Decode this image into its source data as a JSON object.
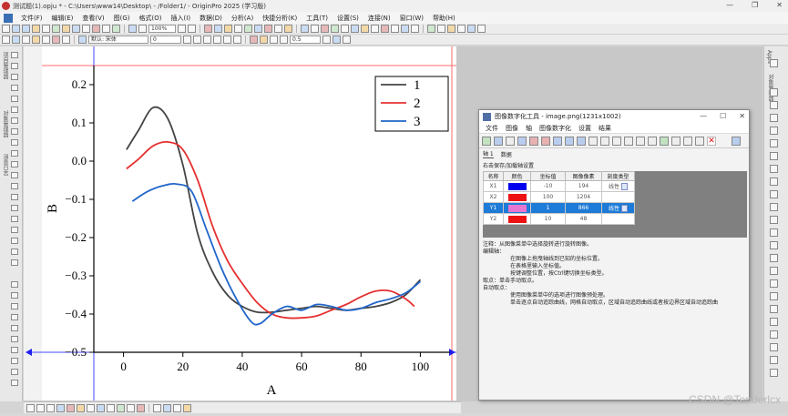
{
  "window": {
    "title": "测试题(1).opju * - C:\\Users\\www14\\Desktop\\ - /Folder1/ - OriginPro 2025 (学习版)",
    "controls": [
      "—",
      "❐",
      "✕"
    ]
  },
  "menubar": {
    "items": [
      "文件(F)",
      "编辑(E)",
      "查看(V)",
      "图(G)",
      "格式(O)",
      "插入(I)",
      "数据(D)",
      "分析(A)",
      "快捷分析(K)",
      "工具(T)",
      "设置(S)",
      "连接(N)",
      "窗口(W)",
      "帮助(H)"
    ]
  },
  "toolbar": {
    "zoom": "100%",
    "font_name": "默认: 宋体",
    "font_size": "0",
    "line_width": "0.5"
  },
  "left_panel": {
    "labels": [
      "项目管理器",
      "对象管理器",
      "消息日志"
    ]
  },
  "right_panel": {
    "labels": [
      "Apps",
      "对象管理器"
    ]
  },
  "graph": {
    "x_axis_title": "A",
    "y_axis_title": "B",
    "legend": [
      "1",
      "2",
      "3"
    ]
  },
  "chart_data": {
    "type": "line",
    "xlabel": "A",
    "ylabel": "B",
    "xlim": [
      -10,
      110
    ],
    "ylim": [
      -0.5,
      0.25
    ],
    "xticks": [
      0,
      20,
      40,
      60,
      80,
      100
    ],
    "yticks": [
      0.2,
      0.1,
      0.0,
      -0.1,
      -0.2,
      -0.3,
      -0.4,
      -0.5
    ],
    "xtick_labels": [
      "0",
      "20",
      "40",
      "60",
      "80",
      "100"
    ],
    "ytick_labels": [
      "0.2",
      "0.1",
      "0.0",
      "−0.1",
      "−0.2",
      "−0.3",
      "−0.4",
      "−0.5"
    ],
    "legend_position": "top-right",
    "series": [
      {
        "name": "1",
        "color": "#444444",
        "x": [
          1,
          5,
          10,
          15,
          20,
          25,
          30,
          35,
          40,
          45,
          50,
          55,
          60,
          65,
          70,
          75,
          80,
          85,
          90,
          95,
          100
        ],
        "y": [
          0.03,
          0.08,
          0.14,
          0.11,
          -0.01,
          -0.19,
          -0.29,
          -0.35,
          -0.38,
          -0.395,
          -0.395,
          -0.39,
          -0.385,
          -0.38,
          -0.385,
          -0.39,
          -0.385,
          -0.38,
          -0.37,
          -0.35,
          -0.31
        ]
      },
      {
        "name": "2",
        "color": "#e53030",
        "x": [
          1,
          5,
          10,
          15,
          20,
          25,
          30,
          35,
          40,
          45,
          50,
          55,
          60,
          65,
          70,
          75,
          80,
          85,
          90,
          95,
          98
        ],
        "y": [
          -0.02,
          0.005,
          0.04,
          0.05,
          0.03,
          -0.05,
          -0.17,
          -0.26,
          -0.32,
          -0.37,
          -0.4,
          -0.41,
          -0.41,
          -0.405,
          -0.39,
          -0.375,
          -0.355,
          -0.34,
          -0.34,
          -0.36,
          -0.38
        ]
      },
      {
        "name": "3",
        "color": "#2166c9",
        "x": [
          3,
          8,
          13,
          18,
          23,
          28,
          33,
          38,
          43,
          46,
          50,
          55,
          60,
          65,
          70,
          75,
          80,
          85,
          90,
          95,
          100
        ],
        "y": [
          -0.105,
          -0.08,
          -0.065,
          -0.06,
          -0.08,
          -0.18,
          -0.28,
          -0.36,
          -0.42,
          -0.425,
          -0.4,
          -0.38,
          -0.39,
          -0.375,
          -0.38,
          -0.39,
          -0.385,
          -0.37,
          -0.36,
          -0.345,
          -0.315
        ]
      }
    ]
  },
  "digitizer": {
    "title": "图像数字化工具 - image.png(1231x1002)",
    "controls": [
      "—",
      "☐",
      "✕"
    ],
    "menu": [
      "文件",
      "图像",
      "轴",
      "图像数字化",
      "设置",
      "结果"
    ],
    "tabs": [
      "轴 1",
      "数据"
    ],
    "section_title": "右击保存/加载轴设置",
    "table": {
      "headers": [
        "名称",
        "颜色",
        "坐标值",
        "图像像素",
        "刻度类型"
      ],
      "rows": [
        {
          "name": "X1",
          "color": "#0000ee",
          "coord": "-10",
          "pixel": "194",
          "scale": "线性"
        },
        {
          "name": "X2",
          "color": "#ee1111",
          "coord": "100",
          "pixel": "1204",
          "scale": ""
        },
        {
          "name": "Y1",
          "color": "#e676cf",
          "coord": "1",
          "pixel": "866",
          "scale": "线性"
        },
        {
          "name": "Y2",
          "color": "#ee1111",
          "coord": "10",
          "pixel": "48",
          "scale": ""
        }
      ]
    },
    "notes": [
      "注释：从图像菜单中选择旋转进行旋转图像。",
      "编辑轴：",
      "在图像上拖曳轴线到已知的坐标位置。",
      "在表格里输入坐标值。",
      "按键调整位置，按Ctrl键切换坐标类型。",
      "取点：单击手动取点。",
      "自动取点：",
      "使用图像菜单中的选项进行图像预处理。",
      "单击逐点自动追踪曲线，网格自动取点，区域自动追踪曲线或者按边界区域自动追踪曲"
    ]
  },
  "watermark": "CSDN @Tenderlcx"
}
